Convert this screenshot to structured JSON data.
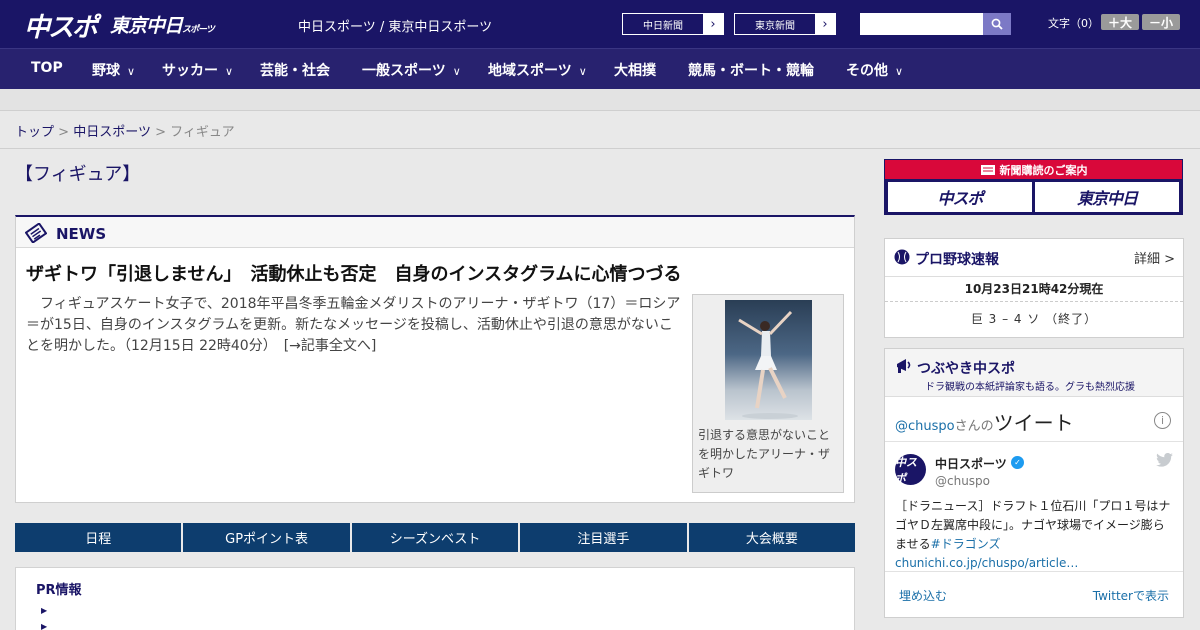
{
  "header": {
    "logo_main": "中スポ",
    "logo_tokyo": "東京中日",
    "logo_tokyo_small": "スポーツ",
    "site_links": "中日スポーツ / 東京中日スポーツ",
    "btn_chunichi": "中日新聞",
    "btn_tokyo": "東京新聞",
    "search_placeholder": "",
    "font_label": "文字（0）",
    "font_larger": "＋大",
    "font_smaller": "－小"
  },
  "nav": [
    {
      "label": "TOP"
    },
    {
      "label": "野球"
    },
    {
      "label": "サッカー"
    },
    {
      "label": "芸能・社会"
    },
    {
      "label": "一般スポーツ"
    },
    {
      "label": "地域スポーツ"
    },
    {
      "label": "大相撲"
    },
    {
      "label": "競馬・ボート・競輪"
    },
    {
      "label": "その他"
    }
  ],
  "breadcrumb": {
    "top": "トップ",
    "section": "中日スポーツ",
    "current": "フィギュア",
    "sep": ">"
  },
  "page_title": "【フィギュア】",
  "news": {
    "label": "NEWS",
    "headline": "ザギトワ「引退しません」　活動休止も否定　自身のインスタグラムに心情つづる",
    "body": "フィギュアスケート女子で、2018年平昌冬季五輪金メダリストのアリーナ・ザギトワ（17）＝ロシア＝が15日、自身のインスタグラムを更新。新たなメッセージを投稿し、活動休止や引退の意思がないことを明かした。（12月15日 22時40分）　[→記事全文へ]",
    "photo_caption": "引退する意思がないことを明かしたアリーナ・ザギトワ"
  },
  "tabs": [
    {
      "label": "日程"
    },
    {
      "label": "GPポイント表"
    },
    {
      "label": "シーズンベスト"
    },
    {
      "label": "注目選手"
    },
    {
      "label": "大会概要"
    }
  ],
  "pr": {
    "title": "PR情報"
  },
  "subscribe": {
    "title": "新聞購読のご案内",
    "logo1": "中スポ",
    "logo2": "東京中日"
  },
  "baseball": {
    "title": "プロ野球速報",
    "detail": "詳細 >",
    "time": "10月23日21時42分現在",
    "score": "巨 3 – 4 ソ （終了）"
  },
  "tweets": {
    "title": "つぶやき中スポ",
    "subtitle": "ドラ観戦の本紙評論家も語る。グラも熱烈応援",
    "handle_prefix": "@chuspo",
    "handle_suffix": "さんの",
    "tweet_word": "ツイート",
    "info": "i",
    "account_name": "中日スポーツ",
    "account_handle": "@chuspo",
    "avatar_text": "中スポ",
    "text_main": "［ドラニュース］ドラフト１位石川「プロ１号はナゴヤＤ左翼席中段に」。ナゴヤ球場でイメージ膨らませる",
    "text_link": "#ドラゴンズchunichi.co.jp/chuspo/article…",
    "embed": "埋め込む",
    "view_on": "Twitterで表示"
  },
  "colors": {
    "brand_navy": "#1a1566",
    "tab_blue": "#0d3d6e",
    "subscribe_red": "#d9083a",
    "link_blue": "#1a6fa8"
  }
}
